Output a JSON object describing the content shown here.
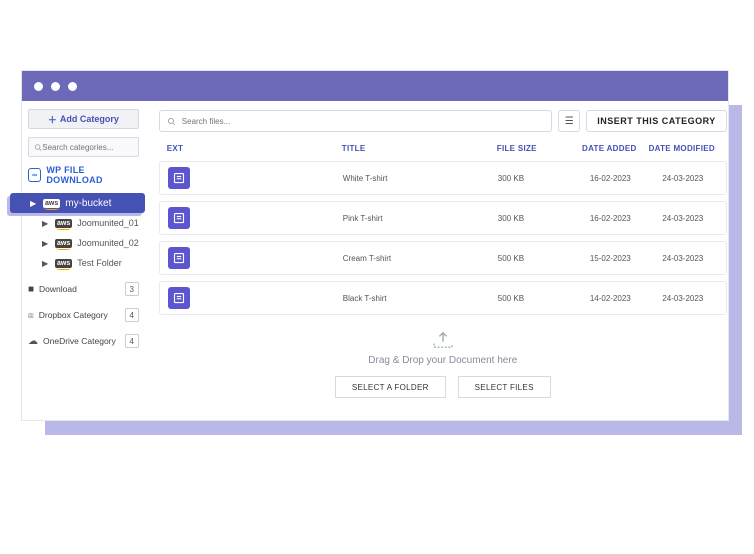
{
  "sidebar": {
    "add_category": "Add Category",
    "search_placeholder": "Search categories...",
    "wp_title": "WP FILE DOWNLOAD",
    "wp_logo_text": "∞",
    "bucket": {
      "aws": "aws",
      "name": "my-bucket"
    },
    "sub": [
      {
        "aws": "aws",
        "name": "Joomunited_01"
      },
      {
        "aws": "aws",
        "name": "Joomunited_02"
      },
      {
        "aws": "aws",
        "name": "Test Folder"
      }
    ],
    "others": [
      {
        "icon": "folder",
        "name": "Download",
        "count": "3"
      },
      {
        "icon": "dropbox",
        "name": "Dropbox Category",
        "count": "4"
      },
      {
        "icon": "cloud",
        "name": "OneDrive Category",
        "count": "4"
      }
    ]
  },
  "main": {
    "search_placeholder": "Search files...",
    "insert_label": "INSERT THIS CATEGORY",
    "headers": {
      "ext": "EXT",
      "title": "TITLE",
      "size": "FILE SIZE",
      "added": "DATE ADDED",
      "modified": "DATE MODIFIED"
    },
    "rows": [
      {
        "title": "White T-shirt",
        "size": "300 KB",
        "added": "16-02-2023",
        "modified": "24-03-2023"
      },
      {
        "title": "Pink T-shirt",
        "size": "300 KB",
        "added": "16-02-2023",
        "modified": "24-03-2023"
      },
      {
        "title": "Cream T-shirt",
        "size": "500 KB",
        "added": "15-02-2023",
        "modified": "24-03-2023"
      },
      {
        "title": "Black T-shirt",
        "size": "500 KB",
        "added": "14-02-2023",
        "modified": "24-03-2023"
      }
    ],
    "drop_text": "Drag & Drop your Document here",
    "select_folder": "SELECT A FOLDER",
    "select_files": "SELECT FILES"
  }
}
